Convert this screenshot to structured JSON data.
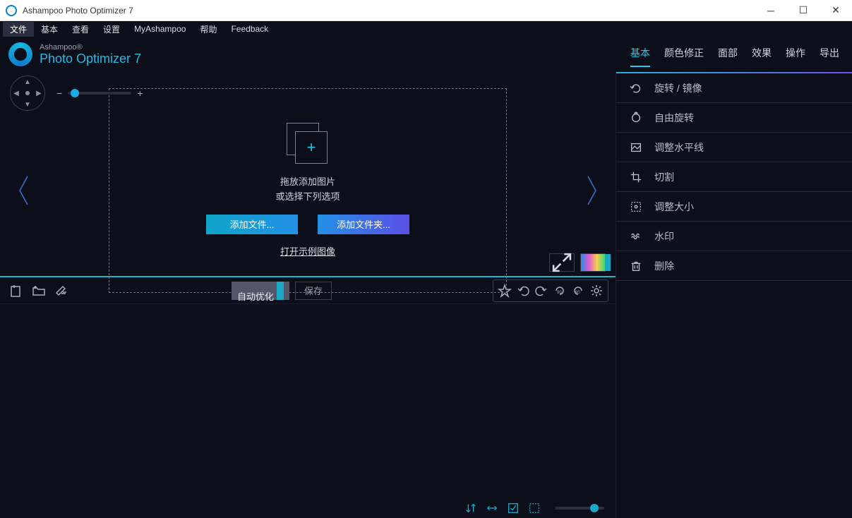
{
  "window": {
    "title": "Ashampoo Photo Optimizer 7"
  },
  "menubar": {
    "items": [
      "文件",
      "基本",
      "查看",
      "设置",
      "MyAshampoo",
      "帮助",
      "Feedback"
    ],
    "active_index": 0
  },
  "brand": {
    "line1": "Ashampoo®",
    "line2": "Photo Optimizer 7"
  },
  "right_tabs": {
    "items": [
      "基本",
      "颜色修正",
      "面部",
      "效果",
      "操作",
      "导出"
    ],
    "active_index": 0
  },
  "right_panel": [
    {
      "icon": "rotate-mirror-icon",
      "label": "旋转 / 镜像"
    },
    {
      "icon": "free-rotate-icon",
      "label": "自由旋转"
    },
    {
      "icon": "horizon-icon",
      "label": "调整水平线"
    },
    {
      "icon": "crop-icon",
      "label": "切割"
    },
    {
      "icon": "resize-icon",
      "label": "调整大小"
    },
    {
      "icon": "watermark-icon",
      "label": "水印"
    },
    {
      "icon": "delete-icon",
      "label": "删除"
    }
  ],
  "dropzone": {
    "line1": "拖放添加图片",
    "line2": "或选择下列选项",
    "add_file": "添加文件...",
    "add_folder": "添加文件夹...",
    "sample_link": "打开示例图像"
  },
  "toolbar": {
    "auto_optimize": "自动优化",
    "save": "保存"
  }
}
